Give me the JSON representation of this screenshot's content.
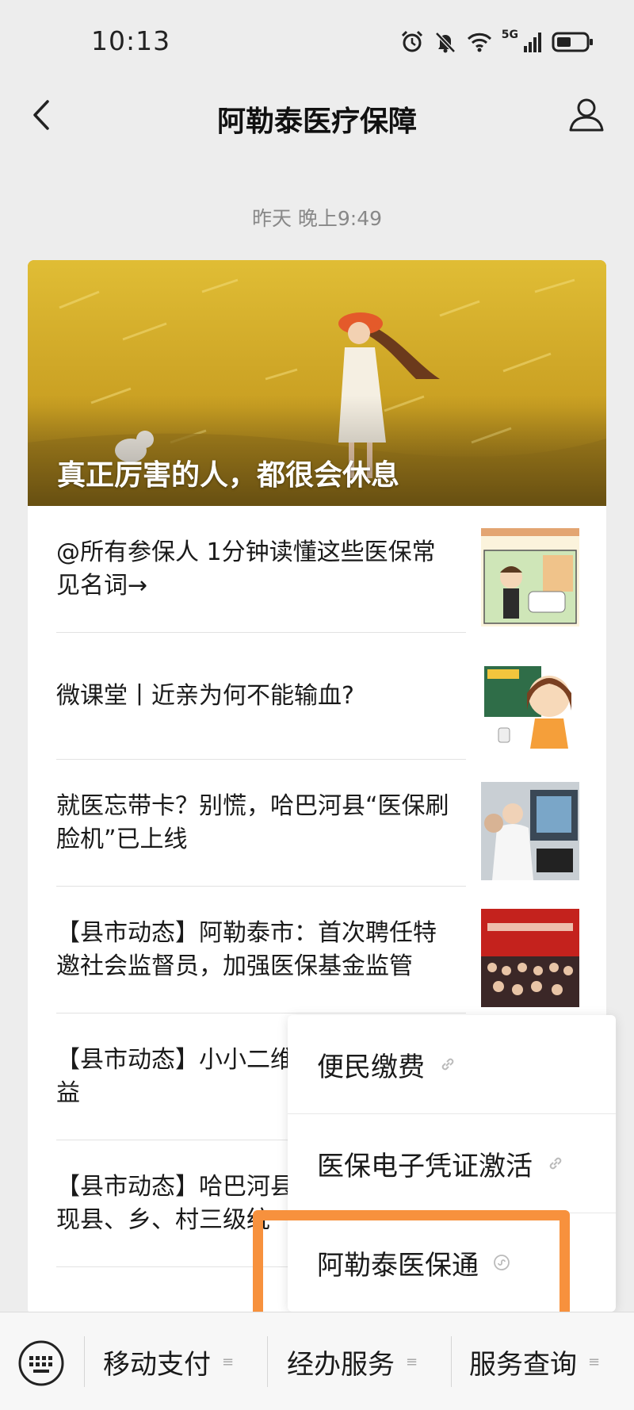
{
  "status_bar": {
    "time": "10:13",
    "network": "5G"
  },
  "header": {
    "title": "阿勒泰医疗保障"
  },
  "message": {
    "timestamp": "昨天 晚上9:49"
  },
  "cover": {
    "title": "真正厉害的人，都很会休息"
  },
  "articles": [
    {
      "title": "@所有参保人 1分钟读懂这些医保常见名词→"
    },
    {
      "title": "微课堂丨近亲为何不能输血?"
    },
    {
      "title": "就医忘带卡？别慌，哈巴河县“医保刷脸机”已上线"
    },
    {
      "title": "【县市动态】阿勒泰市：首次聘任特邀社会监督员，加强医保基金监管"
    },
    {
      "title": "【县市动态】小小二维"
    },
    {
      "title": "益"
    },
    {
      "title": "【县市动态】哈巴河县"
    },
    {
      "title": "现县、乡、村三级统"
    }
  ],
  "popup_menu": {
    "items": [
      {
        "label": "便民缴费"
      },
      {
        "label": "医保电子凭证激活"
      },
      {
        "label": "阿勒泰医保通"
      }
    ]
  },
  "bottom_menu": {
    "items": [
      {
        "label": "移动支付"
      },
      {
        "label": "经办服务"
      },
      {
        "label": "服务查询"
      }
    ]
  },
  "colors": {
    "highlight": "#f7913d",
    "background": "#ededed"
  }
}
